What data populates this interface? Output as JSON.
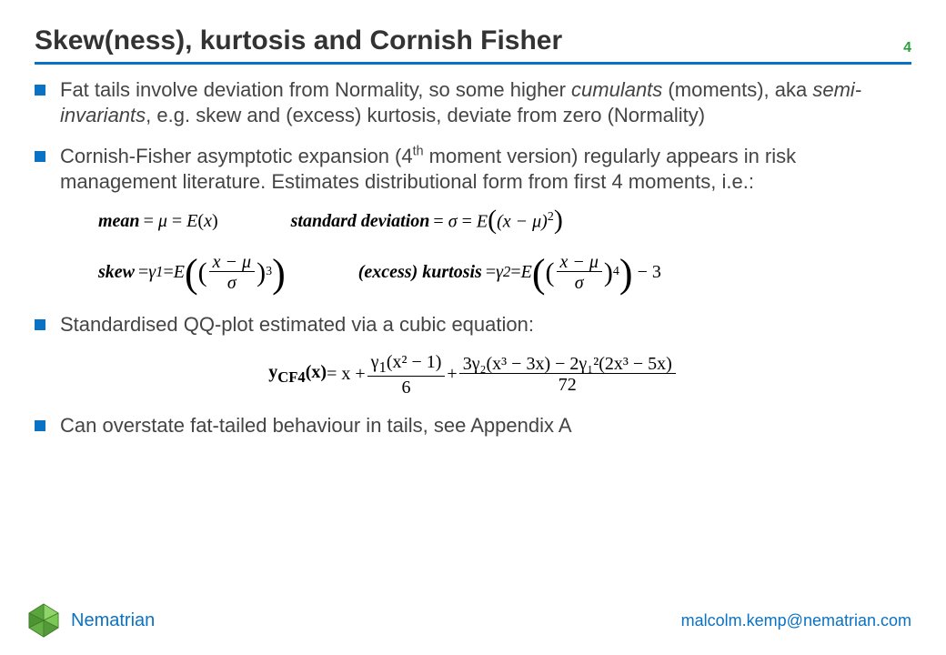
{
  "header": {
    "title": "Skew(ness), kurtosis and Cornish Fisher",
    "page_number": "4"
  },
  "bullets": {
    "b1_pre": "Fat tails involve deviation from Normality, so some higher ",
    "b1_em1": "cumulants",
    "b1_mid": " (moments), aka ",
    "b1_em2": "semi-invariants",
    "b1_post": ", e.g. skew and (excess) kurtosis, deviate from zero (Normality)",
    "b2_pre": "Cornish-Fisher asymptotic expansion (4",
    "b2_sup": "th",
    "b2_post": " moment version) regularly appears in risk management literature. Estimates distributional form from first 4 moments, i.e.:",
    "b3": "Standardised QQ-plot estimated via a cubic equation:",
    "b4": "Can overstate fat-tailed behaviour in tails, see Appendix A"
  },
  "equations": {
    "mean": {
      "label": "mean",
      "symbol": "μ",
      "rhs_prefix": "E",
      "rhs_arg": "x"
    },
    "sd": {
      "label": "standard deviation",
      "symbol": "σ",
      "rhs_prefix": "E",
      "rhs_arg_open": "(x − μ)",
      "rhs_pow": "2"
    },
    "skew": {
      "label": "skew",
      "symbol": "γ",
      "sub": "1",
      "rhs_prefix": "E",
      "frac_num": "x − μ",
      "frac_den": "σ",
      "pow": "3"
    },
    "kurt": {
      "label": "(excess) kurtosis",
      "symbol": "γ",
      "sub": "2",
      "rhs_prefix": "E",
      "frac_num": "x − μ",
      "frac_den": "σ",
      "pow": "4",
      "tail": "− 3"
    },
    "cf": {
      "lhs_base": "y",
      "lhs_sub": "CF4",
      "lhs_arg": "x",
      "eq": " = x + ",
      "t1_num_sym": "γ",
      "t1_num_sub": "1",
      "t1_num_rest": "(x² − 1)",
      "t1_den": "6",
      "plus": " + ",
      "t2_num": "3γ₂(x³ − 3x) − 2γ₁²(2x³ − 5x)",
      "t2_den": "72"
    }
  },
  "footer": {
    "brand": "Nematrian",
    "email": "malcolm.kemp@nematrian.com"
  }
}
